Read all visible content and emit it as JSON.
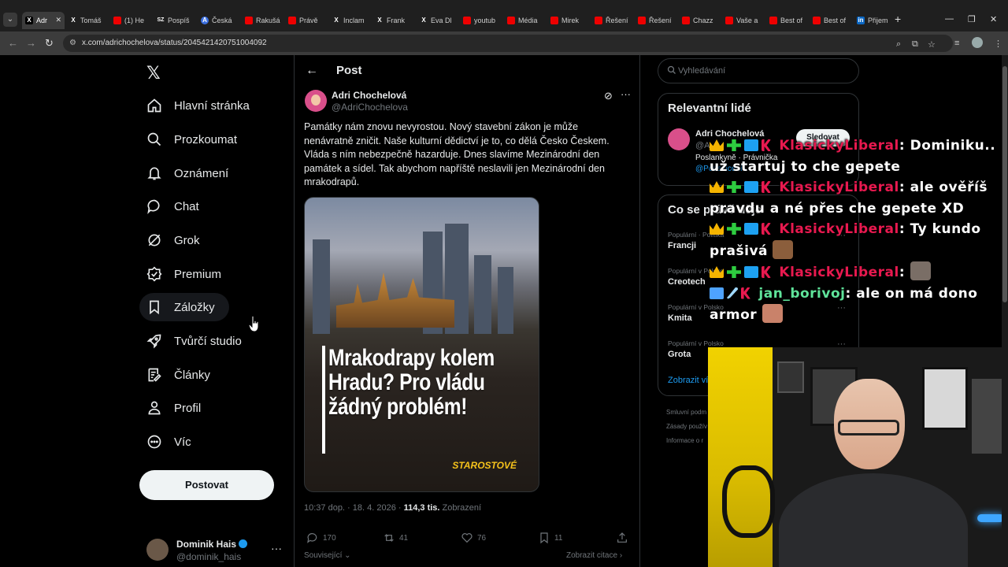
{
  "browser": {
    "tabs": [
      {
        "label": "Adr",
        "icon": "x-icon",
        "active": true
      },
      {
        "label": "Tomáš",
        "icon": "x-icon"
      },
      {
        "label": "(1) He",
        "icon": "youtube-icon"
      },
      {
        "label": "Pospíš",
        "icon": "sz-icon"
      },
      {
        "label": "Česká",
        "icon": "a-icon"
      },
      {
        "label": "Rakušá",
        "icon": "youtube-icon"
      },
      {
        "label": "Právě",
        "icon": "youtube-icon"
      },
      {
        "label": "Inclam",
        "icon": "x-icon"
      },
      {
        "label": "Frank",
        "icon": "x-icon"
      },
      {
        "label": "Eva Dl",
        "icon": "x-icon"
      },
      {
        "label": "youtub",
        "icon": "youtube-icon"
      },
      {
        "label": "Média",
        "icon": "youtube-icon"
      },
      {
        "label": "Mirek",
        "icon": "youtube-icon"
      },
      {
        "label": "Řešení",
        "icon": "youtube-icon"
      },
      {
        "label": "Řešení",
        "icon": "youtube-icon"
      },
      {
        "label": "Chazz",
        "icon": "youtube-icon"
      },
      {
        "label": "Vaše a",
        "icon": "youtube-icon"
      },
      {
        "label": "Best of",
        "icon": "youtube-icon"
      },
      {
        "label": "Best of",
        "icon": "youtube-icon"
      },
      {
        "label": "Přijem",
        "icon": "linkedin-icon"
      }
    ],
    "url": "x.com/adrichochelova/status/2045421420751004092"
  },
  "nav": {
    "items": [
      {
        "label": "Hlavní stránka",
        "icon": "home-icon"
      },
      {
        "label": "Prozkoumat",
        "icon": "search-icon"
      },
      {
        "label": "Oznámení",
        "icon": "bell-icon"
      },
      {
        "label": "Chat",
        "icon": "chat-icon"
      },
      {
        "label": "Grok",
        "icon": "grok-icon"
      },
      {
        "label": "Premium",
        "icon": "premium-icon"
      },
      {
        "label": "Záložky",
        "icon": "bookmark-icon"
      },
      {
        "label": "Tvůrčí studio",
        "icon": "rocket-icon"
      },
      {
        "label": "Články",
        "icon": "articles-icon"
      },
      {
        "label": "Profil",
        "icon": "profile-icon"
      },
      {
        "label": "Víc",
        "icon": "more-circle-icon"
      }
    ],
    "post_button": "Postovat",
    "account": {
      "name": "Dominik Hais",
      "handle": "@dominik_hais"
    }
  },
  "main": {
    "title": "Post",
    "author": {
      "name": "Adri Chochelová",
      "handle": "@AdriChochelova"
    },
    "text": "Památky nám znovu nevyrostou. Nový stavební zákon je může nenávratně zničit. Naše kulturní dědictví je to, co dělá Česko Českem. Vláda s ním nebezpečně hazarduje. Dnes slavíme Mezinárodní den památek a sídel. Tak abychom napříště neslavili jen Mezinárodní den mrakodrapů.",
    "image": {
      "headline": "Mrakodrapy kolem Hradu? Pro vládu žádný problém!",
      "brand": "STAROSTOVÉ"
    },
    "meta": {
      "time": "10:37 dop. · 18. 4. 2026 · ",
      "views": "114,3 tis.",
      "views_label": " Zobrazení"
    },
    "actions": {
      "replies": "170",
      "reposts": "41",
      "likes": "76",
      "bookmarks": "11"
    },
    "related_label": "Související",
    "quotes_label": "Zobrazit citace"
  },
  "sidebar": {
    "search_placeholder": "Vyhledávání",
    "relevant": {
      "title": "Relevantní lidé",
      "name": "Adri Chochelová",
      "handle": "@A",
      "bio": "Poslankyně · Právnička",
      "bio_link": "@Podsvícení",
      "follow": "Sledovat"
    },
    "trends": {
      "title": "Co se právě děje",
      "items": [
        {
          "context": "Populární · Politika",
          "name": "Francji"
        },
        {
          "context": "Populární v Polsko",
          "name": "Creotech"
        },
        {
          "context": "Populární v Polsko",
          "name": "Kmita"
        },
        {
          "context": "Populární v Polsko",
          "name": "Grota"
        }
      ],
      "show_more": "Zobrazit víc"
    },
    "footer": [
      "Smluvní podm",
      "Zásady použív",
      "Informace o r"
    ]
  },
  "chat": [
    {
      "user": "KlasickyLiberal",
      "color": "#e8194f",
      "message": ": Dominiku.. už startuj to che gepete"
    },
    {
      "user": "KlasickyLiberal",
      "color": "#e8194f",
      "message": ": ale ověříš pravdu a né přes che gepete XD"
    },
    {
      "user": "KlasickyLiberal",
      "color": "#e8194f",
      "message": ": Ty kundo prašivá"
    },
    {
      "user": "KlasickyLiberal",
      "color": "#e8194f",
      "message": ":"
    },
    {
      "user": "jan_borivoj",
      "color": "#5fe39a",
      "message": ": ale on má dono armor"
    }
  ]
}
